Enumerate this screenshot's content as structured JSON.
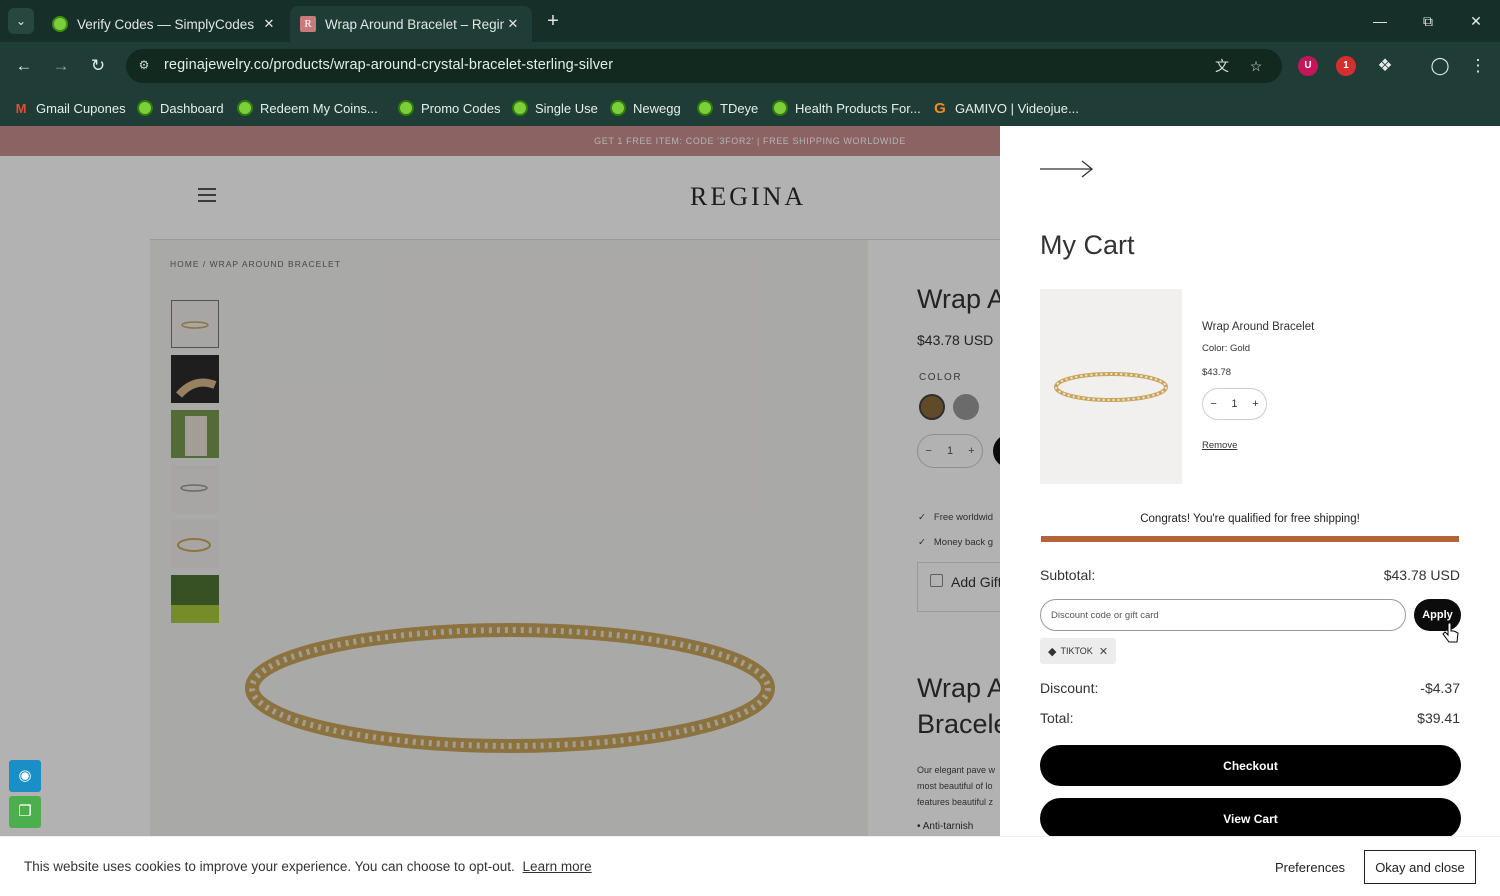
{
  "browser": {
    "tabs": [
      {
        "title": "Verify Codes — SimplyCodes",
        "active": false
      },
      {
        "title": "Wrap Around Bracelet – Regina",
        "active": true
      }
    ],
    "url": "reginajewelry.co/products/wrap-around-crystal-bracelet-sterling-silver",
    "extension_badge": "1",
    "bookmarks": [
      {
        "label": "Gmail Cupones",
        "icon": "gmail-icon"
      },
      {
        "label": "Dashboard",
        "icon": "simplycodes-icon"
      },
      {
        "label": "Redeem My Coins...",
        "icon": "simplycodes-icon"
      },
      {
        "label": "Promo Codes",
        "icon": "simplycodes-icon"
      },
      {
        "label": "Single Use",
        "icon": "simplycodes-icon"
      },
      {
        "label": "Newegg",
        "icon": "simplycodes-icon"
      },
      {
        "label": "TDeye",
        "icon": "simplycodes-icon"
      },
      {
        "label": "Health Products For...",
        "icon": "simplycodes-icon"
      },
      {
        "label": "GAMIVO | Videojue...",
        "icon": "gamivo-icon"
      }
    ]
  },
  "site": {
    "promo": "GET 1 FREE ITEM: CODE '3FOR2' | FREE SHIPPING WORLDWIDE",
    "logo": "REGINA",
    "breadcrumb": "HOME  /  WRAP AROUND BRACELET",
    "product_title": "Wrap A",
    "product_price": "$43.78 USD",
    "color_label": "COLOR",
    "qty": "1",
    "perks": [
      "Free worldwid",
      "Money back g"
    ],
    "gift_label": "Add Gift",
    "title2_line1": "Wrap A",
    "title2_line2": "Bracele",
    "description": [
      "Our elegant pave w",
      "most beautiful of lo",
      "features beautiful z"
    ],
    "anti_tarnish": "• Anti-tarnish"
  },
  "cart": {
    "title": "My Cart",
    "item": {
      "name": "Wrap Around Bracelet",
      "color": "Color: Gold",
      "price": "$43.78",
      "qty": "1",
      "remove": "Remove"
    },
    "shipping_message": "Congrats! You're qualified for free shipping!",
    "shipping_progress": 1.0,
    "subtotal_label": "Subtotal:",
    "subtotal_value": "$43.78 USD",
    "discount_placeholder": "Discount code or gift card",
    "apply_label": "Apply",
    "applied_code": "TIKTOK",
    "discount_label": "Discount:",
    "discount_value": "-$4.37",
    "total_label": "Total:",
    "total_value": "$39.41",
    "checkout_label": "Checkout",
    "view_cart_label": "View Cart"
  },
  "cookie": {
    "text": "This website uses cookies to improve your experience. You can choose to opt-out.",
    "learn_more": "Learn more",
    "preferences": "Preferences",
    "okay": "Okay and close"
  },
  "colors": {
    "chrome_bg": "#1f3d36",
    "promo_bg": "#c98f8f",
    "progress": "#b5633a",
    "button_black": "#000000"
  }
}
